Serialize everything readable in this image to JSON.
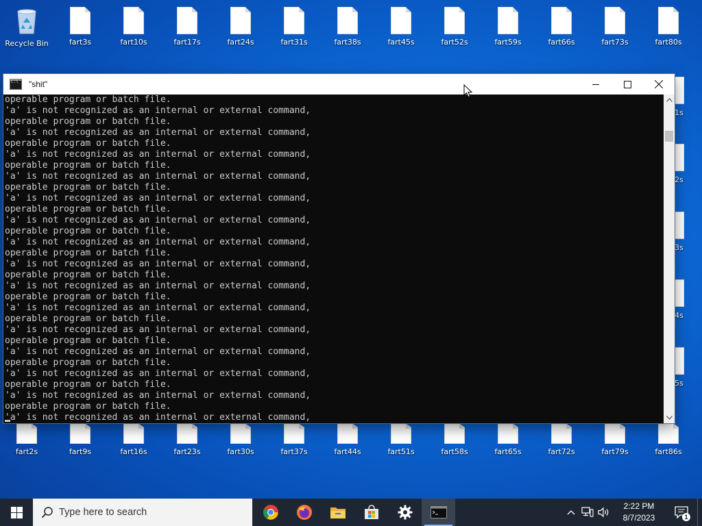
{
  "desktop": {
    "top_row": [
      {
        "label": "Recycle Bin",
        "icon": "recycle-bin-icon"
      },
      {
        "label": "fart3s",
        "icon": "file-icon"
      },
      {
        "label": "fart10s",
        "icon": "file-icon"
      },
      {
        "label": "fart17s",
        "icon": "file-icon"
      },
      {
        "label": "fart24s",
        "icon": "file-icon"
      },
      {
        "label": "fart31s",
        "icon": "file-icon"
      },
      {
        "label": "fart38s",
        "icon": "file-icon"
      },
      {
        "label": "fart45s",
        "icon": "file-icon"
      },
      {
        "label": "fart52s",
        "icon": "file-icon"
      },
      {
        "label": "fart59s",
        "icon": "file-icon"
      },
      {
        "label": "fart66s",
        "icon": "file-icon"
      },
      {
        "label": "fart73s",
        "icon": "file-icon"
      },
      {
        "label": "fart80s",
        "icon": "file-icon"
      }
    ],
    "bottom_row": [
      {
        "label": "fart2s",
        "icon": "file-icon"
      },
      {
        "label": "fart9s",
        "icon": "file-icon"
      },
      {
        "label": "fart16s",
        "icon": "file-icon"
      },
      {
        "label": "fart23s",
        "icon": "file-icon"
      },
      {
        "label": "fart30s",
        "icon": "file-icon"
      },
      {
        "label": "fart37s",
        "icon": "file-icon"
      },
      {
        "label": "fart44s",
        "icon": "file-icon"
      },
      {
        "label": "fart51s",
        "icon": "file-icon"
      },
      {
        "label": "fart58s",
        "icon": "file-icon"
      },
      {
        "label": "fart65s",
        "icon": "file-icon"
      },
      {
        "label": "fart72s",
        "icon": "file-icon"
      },
      {
        "label": "fart79s",
        "icon": "file-icon"
      },
      {
        "label": "fart86s",
        "icon": "file-icon"
      }
    ],
    "partially_hidden_labels": [
      "1s",
      "2s",
      "3s",
      "4s",
      "5s"
    ]
  },
  "console": {
    "title": "\"shit\"",
    "lines": [
      "operable program or batch file.",
      "'a' is not recognized as an internal or external command,",
      "operable program or batch file.",
      "'a' is not recognized as an internal or external command,",
      "operable program or batch file.",
      "'a' is not recognized as an internal or external command,",
      "operable program or batch file.",
      "'a' is not recognized as an internal or external command,",
      "operable program or batch file.",
      "'a' is not recognized as an internal or external command,",
      "operable program or batch file.",
      "'a' is not recognized as an internal or external command,",
      "operable program or batch file.",
      "'a' is not recognized as an internal or external command,",
      "operable program or batch file.",
      "'a' is not recognized as an internal or external command,",
      "operable program or batch file.",
      "'a' is not recognized as an internal or external command,",
      "operable program or batch file.",
      "'a' is not recognized as an internal or external command,",
      "operable program or batch file.",
      "'a' is not recognized as an internal or external command,",
      "operable program or batch file.",
      "'a' is not recognized as an internal or external command,",
      "operable program or batch file.",
      "'a' is not recognized as an internal or external command,",
      "operable program or batch file.",
      "'a' is not recognized as an internal or external command,",
      "operable program or batch file.",
      "'a' is not recognized as an internal or external command,",
      "operable program or batch file."
    ],
    "colors": {
      "background": "#0c0c0c",
      "text": "#cccccc"
    }
  },
  "taskbar": {
    "search_placeholder": "Type here to search",
    "apps": [
      {
        "name": "chrome-icon",
        "active": false
      },
      {
        "name": "firefox-icon",
        "active": false
      },
      {
        "name": "file-explorer-icon",
        "active": false
      },
      {
        "name": "microsoft-store-icon",
        "active": false
      },
      {
        "name": "settings-icon",
        "active": false
      },
      {
        "name": "command-prompt-icon",
        "active": true
      }
    ],
    "clock_time": "2:22 PM",
    "clock_date": "8/7/2023",
    "notification_count": "1",
    "colors": {
      "taskbar": "#1f2633",
      "accent": "#8db8f0"
    }
  }
}
